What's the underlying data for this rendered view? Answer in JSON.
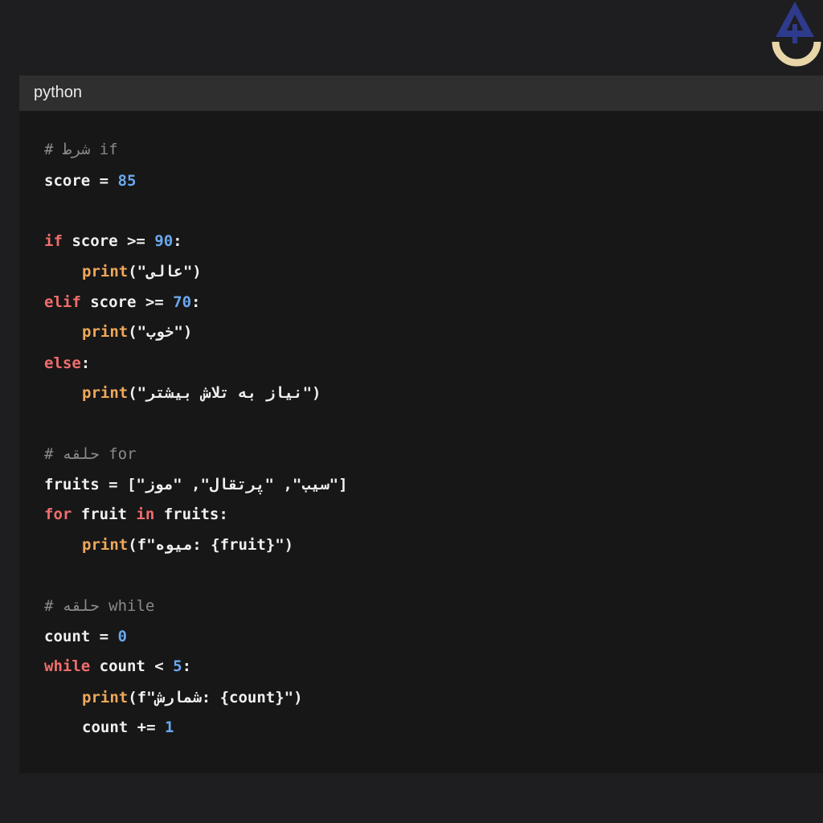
{
  "header": {
    "language": "python"
  },
  "logo": {
    "name": "logo-icon",
    "colors": {
      "primary": "#2e3a8c",
      "secondary": "#e8d6a8"
    }
  },
  "code": {
    "l1": {
      "hash": "#",
      "text": "شرط",
      "kw": "if"
    },
    "l2": {
      "var": "score",
      "op": " = ",
      "num": "85"
    },
    "l4": {
      "kw": "if",
      "rest": " score >= ",
      "num": "90",
      "colon": ":"
    },
    "l5": {
      "fn": "print",
      "open": "(\"",
      "str": "عالی",
      "close": "\")"
    },
    "l6": {
      "kw": "elif",
      "rest": " score >= ",
      "num": "70",
      "colon": ":"
    },
    "l7": {
      "fn": "print",
      "open": "(\"",
      "str": "خوب",
      "close": "\")"
    },
    "l8": {
      "kw": "else",
      "colon": ":"
    },
    "l9": {
      "fn": "print",
      "open": "(\"",
      "str": "نیاز به تلاش بیشتر",
      "close": "\")"
    },
    "l11": {
      "hash": "#",
      "text": "حلقه",
      "kw": "for"
    },
    "l12": {
      "var": "fruits",
      "rest": " = [\"سیب\", \"پرتقال\", \"موز\"]"
    },
    "l13": {
      "kw1": "for",
      "mid": " fruit ",
      "kw2": "in",
      "rest": " fruits:"
    },
    "l14": {
      "fn": "print",
      "rest": "(f\"میوه: {fruit}\")"
    },
    "l16": {
      "hash": "#",
      "text": "حلقه",
      "kw": "while"
    },
    "l17": {
      "var": "count",
      "op": " = ",
      "num": "0"
    },
    "l18": {
      "kw": "while",
      "rest": " count < ",
      "num": "5",
      "colon": ":"
    },
    "l19": {
      "fn": "print",
      "rest": "(f\"شمارش: {count}\")"
    },
    "l20": {
      "var": "count",
      "op": " += ",
      "num": "1"
    }
  }
}
